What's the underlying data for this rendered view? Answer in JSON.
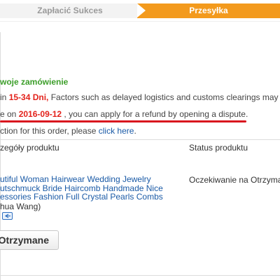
{
  "steps": {
    "done_label": "Zapłacić Sukces",
    "active_label": "Przesyłka"
  },
  "order": {
    "panel_title": "woje zamówienie",
    "delivery_prefix": "in ",
    "delivery_days": "15-34 Dni,",
    "delivery_suffix": " Factors such as delayed logistics and customs clearings may l",
    "refund_prefix": "e on ",
    "refund_date": "2016-09-12",
    "refund_suffix": " , you can apply for a refund by opening a dispute.",
    "action_prefix": "ction for this order, please ",
    "action_link": "click here",
    "action_suffix": "."
  },
  "table": {
    "col_details": "zegóły produktu",
    "col_status": "Status produktu"
  },
  "product": {
    "title_line1": "utiful Woman Hairwear Wedding Jewelry",
    "title_line2": "utschmuck Bride Haircomb Handmade Nice",
    "title_line3": "essories Fashion Full Crystal Pearls Combs",
    "seller": "hua Wang)",
    "status": "Oczekiwanie na Otrzymani",
    "message_icon": "message-icon"
  },
  "actions": {
    "confirm_label": "Otrzymane"
  },
  "colors": {
    "accent_orange": "#f39a1d",
    "success_green": "#3c9e2a",
    "alert_red": "#e3221b",
    "link_blue": "#1a5aa6"
  }
}
